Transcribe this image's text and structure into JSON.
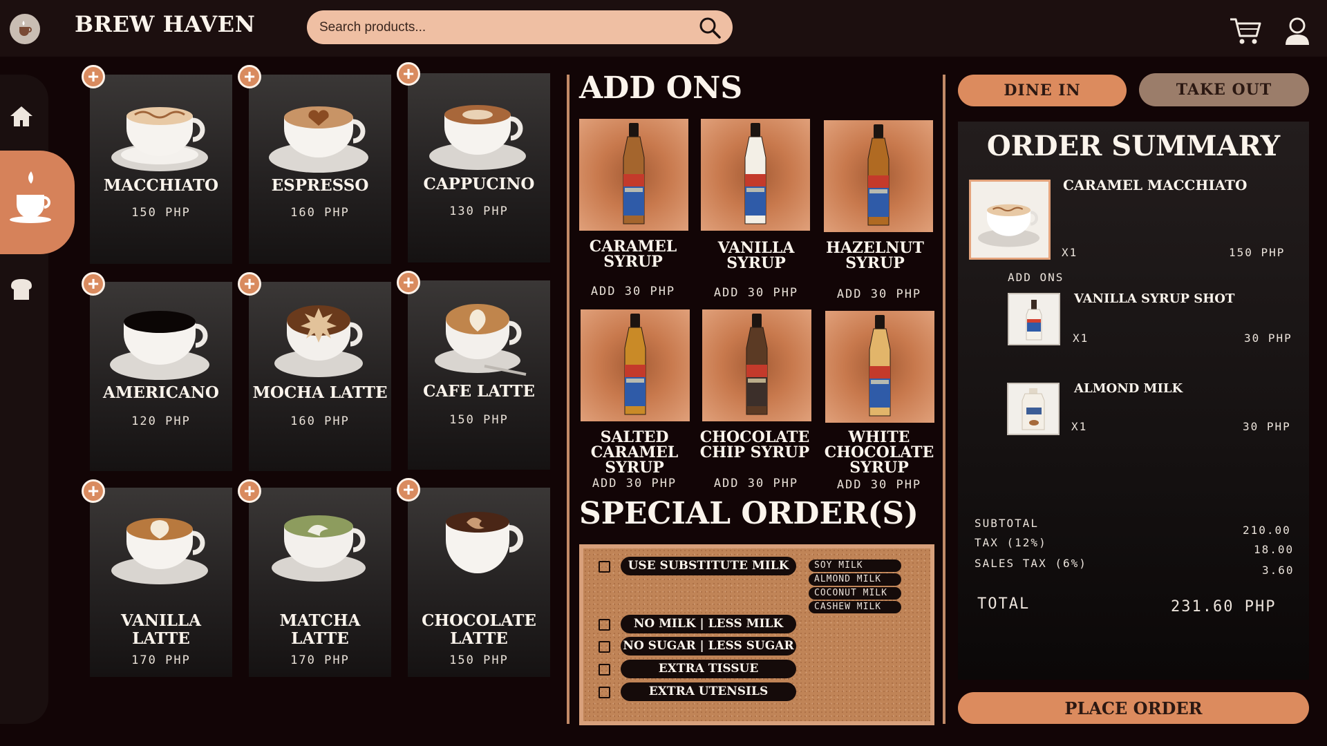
{
  "header": {
    "brand": "BREW HAVEN",
    "search_placeholder": "Search products..."
  },
  "icons": {
    "logo": "coffee-logo-icon",
    "search": "search-icon",
    "cart": "cart-icon",
    "user": "user-icon",
    "sidebar": [
      "home-icon",
      "coffee-cup-icon",
      "bread-icon"
    ],
    "add": "plus-icon"
  },
  "colors": {
    "accent": "#dc8b5e",
    "background": "#120506",
    "panel": "#1c0f0f",
    "search_bg": "#efbfa3"
  },
  "products": [
    {
      "name": "MACCHIATO",
      "price": "150 PHP",
      "image": "macchiato-image"
    },
    {
      "name": "ESPRESSO",
      "price": "160 PHP",
      "image": "espresso-image"
    },
    {
      "name": "CAPPUCINO",
      "price": "130 PHP",
      "image": "cappucino-image"
    },
    {
      "name": "AMERICANO",
      "price": "120 PHP",
      "image": "americano-image"
    },
    {
      "name": "MOCHA LATTE",
      "price": "160 PHP",
      "image": "mocha-latte-image"
    },
    {
      "name": "CAFE LATTE",
      "price": "150 PHP",
      "image": "cafe-latte-image"
    },
    {
      "name": "VANILLA LATTE",
      "price": "170 PHP",
      "image": "vanilla-latte-image"
    },
    {
      "name": "MATCHA LATTE",
      "price": "170 PHP",
      "image": "matcha-latte-image"
    },
    {
      "name": "CHOCOLATE LATTE",
      "price": "150 PHP",
      "image": "chocolate-latte-image"
    }
  ],
  "addons": {
    "title": "ADD ONS",
    "items": [
      {
        "name": "CARAMEL SYRUP",
        "price": "ADD 30 PHP",
        "bottle_label_color": "#2f5ba8",
        "liquid": "#a4652d"
      },
      {
        "name": "VANILLA SYRUP",
        "price": "ADD 30 PHP",
        "bottle_label_color": "#2f5ba8",
        "liquid": "#f3efe6"
      },
      {
        "name": "HAZELNUT SYRUP",
        "price": "ADD 30 PHP",
        "bottle_label_color": "#2f5ba8",
        "liquid": "#b06a22"
      },
      {
        "name": "SALTED CARAMEL SYRUP",
        "price": "ADD 30 PHP",
        "bottle_label_color": "#2f5ba8",
        "liquid": "#c98a27"
      },
      {
        "name": "CHOCOLATE CHIP SYRUP",
        "price": "ADD 30 PHP",
        "bottle_label_color": "#3c2f2a",
        "liquid": "#5b3a24"
      },
      {
        "name": "WHITE CHOCOLATE SYRUP",
        "price": "ADD 30 PHP",
        "bottle_label_color": "#2f5ba8",
        "liquid": "#e2b56a"
      }
    ]
  },
  "special_orders": {
    "title": "SPECIAL ORDER(S)",
    "options": [
      {
        "label": "USE SUBSTITUTE MILK",
        "checked": false
      },
      {
        "label": "NO MILK | LESS MILK",
        "checked": false
      },
      {
        "label": "NO SUGAR | LESS SUGAR",
        "checked": false
      },
      {
        "label": "EXTRA TISSUE",
        "checked": false
      },
      {
        "label": "EXTRA UTENSILS",
        "checked": false
      }
    ],
    "milk_options": [
      "SOY MILK",
      "ALMOND MILK",
      "COCONUT MILK",
      "CASHEW MILK"
    ]
  },
  "order_type": {
    "dine_in": "DINE IN",
    "take_out": "TAKE OUT"
  },
  "summary": {
    "title": "ORDER SUMMARY",
    "main_item": {
      "name": "CARAMEL MACCHIATO",
      "qty": "X1",
      "price": "150 PHP"
    },
    "addons_label": "ADD ONS",
    "addons": [
      {
        "name": "VANILLA SYRUP SHOT",
        "qty": "X1",
        "price": "30 PHP"
      },
      {
        "name": "ALMOND MILK",
        "qty": "X1",
        "price": "30 PHP"
      }
    ],
    "subtotal_label": "SUBTOTAL",
    "subtotal": "210.00",
    "tax_label": "TAX (12%)",
    "tax": "18.00",
    "sales_tax_label": "SALES TAX (6%)",
    "sales_tax": "3.60",
    "total_label": "TOTAL",
    "total": "231.60 PHP"
  },
  "place_order": "PLACE ORDER"
}
